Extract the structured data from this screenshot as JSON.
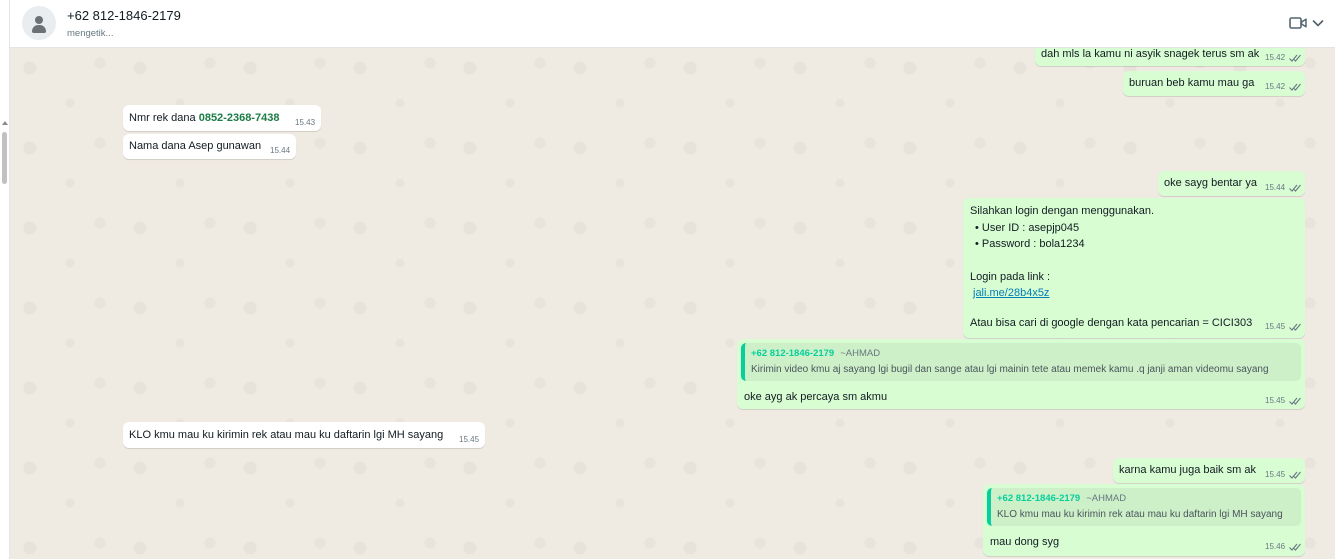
{
  "header": {
    "contact_name": "+62 812-1846-2179",
    "status": "mengetik..."
  },
  "messages": [
    {
      "text": "dah mls la kamu ni asyik snagek terus sm ak",
      "time": "15.42"
    },
    {
      "text": "buruan beb kamu mau ga",
      "time": "15.42"
    },
    {
      "text_before": "Nmr rek dana ",
      "highlight": "0852-2368-7438",
      "time": "15.43"
    },
    {
      "text": "Nama dana Asep gunawan",
      "time": "15.44"
    },
    {
      "text": "oke sayg bentar ya",
      "time": "15.44"
    },
    {
      "line1": "Silahkan login dengan menggunakan.",
      "line2": "• User ID : asepjp045",
      "line3": "• Password : bola1234",
      "line4": "Login pada link :",
      "link": "jali.me/28b4x5z",
      "line5": "Atau bisa cari di google dengan kata pencarian = CICI303",
      "time": "15.45"
    },
    {
      "quote_author": "+62 812-1846-2179",
      "quote_alias": "~AHMAD",
      "quote_text": "Kirimin video kmu aj sayang lgi bugil dan sange atau lgi mainin tete atau memek kamu .q janji aman videomu sayang",
      "text": "oke ayg ak percaya sm akmu",
      "time": "15.45"
    },
    {
      "text": "KLO kmu mau ku kirimin rek atau mau ku daftarin lgi MH sayang",
      "time": "15.45"
    },
    {
      "text": "karna kamu juga baik sm ak",
      "time": "15.45"
    },
    {
      "quote_author": "+62 812-1846-2179",
      "quote_alias": "~AHMAD",
      "quote_text": "KLO kmu mau ku kirimin rek atau mau ku daftarin lgi MH sayang",
      "text": "mau dong syg",
      "time": "15.46"
    }
  ],
  "colors": {
    "chat_bg": "#efeae2",
    "outgoing_bubble": "#d9fdd3",
    "incoming_bubble": "#ffffff",
    "quote_accent": "#06cf9c",
    "read_ticks": "#667781"
  },
  "icons": {
    "avatar": "default-avatar-icon",
    "video": "video-call-icon",
    "menu": "chevron-down-icon",
    "ticks": "double-check-icon"
  }
}
